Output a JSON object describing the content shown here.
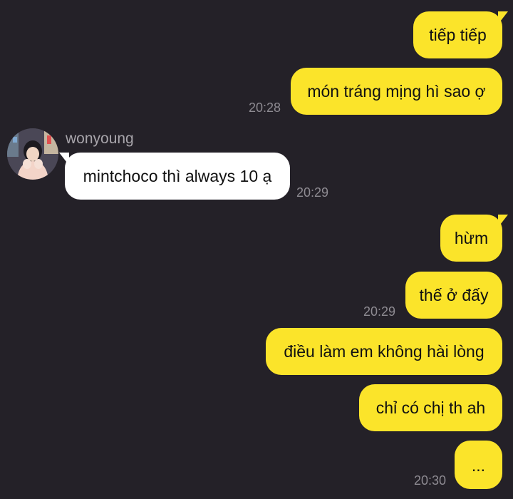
{
  "contact": {
    "name": "wonyoung",
    "avatar_icon": "profile-photo"
  },
  "messages": [
    {
      "from": "me",
      "text": "tiếp tiếp"
    },
    {
      "from": "me",
      "text": "món tráng mịng hì sao ợ",
      "time": "20:28"
    },
    {
      "from": "wonyoung",
      "text": "mintchoco thì always 10 ạ",
      "time": "20:29"
    },
    {
      "from": "me",
      "text": "hừm"
    },
    {
      "from": "me",
      "text": "thế ở đấy",
      "time": "20:29"
    },
    {
      "from": "me",
      "text": "điều làm em không hài lòng"
    },
    {
      "from": "me",
      "text": "chỉ có chị th ah"
    },
    {
      "from": "me",
      "text": "...",
      "time": "20:30"
    }
  ],
  "colors": {
    "background": "#242128",
    "outgoing_bubble": "#fbe42a",
    "incoming_bubble": "#ffffff",
    "timestamp": "#8e8b92"
  }
}
